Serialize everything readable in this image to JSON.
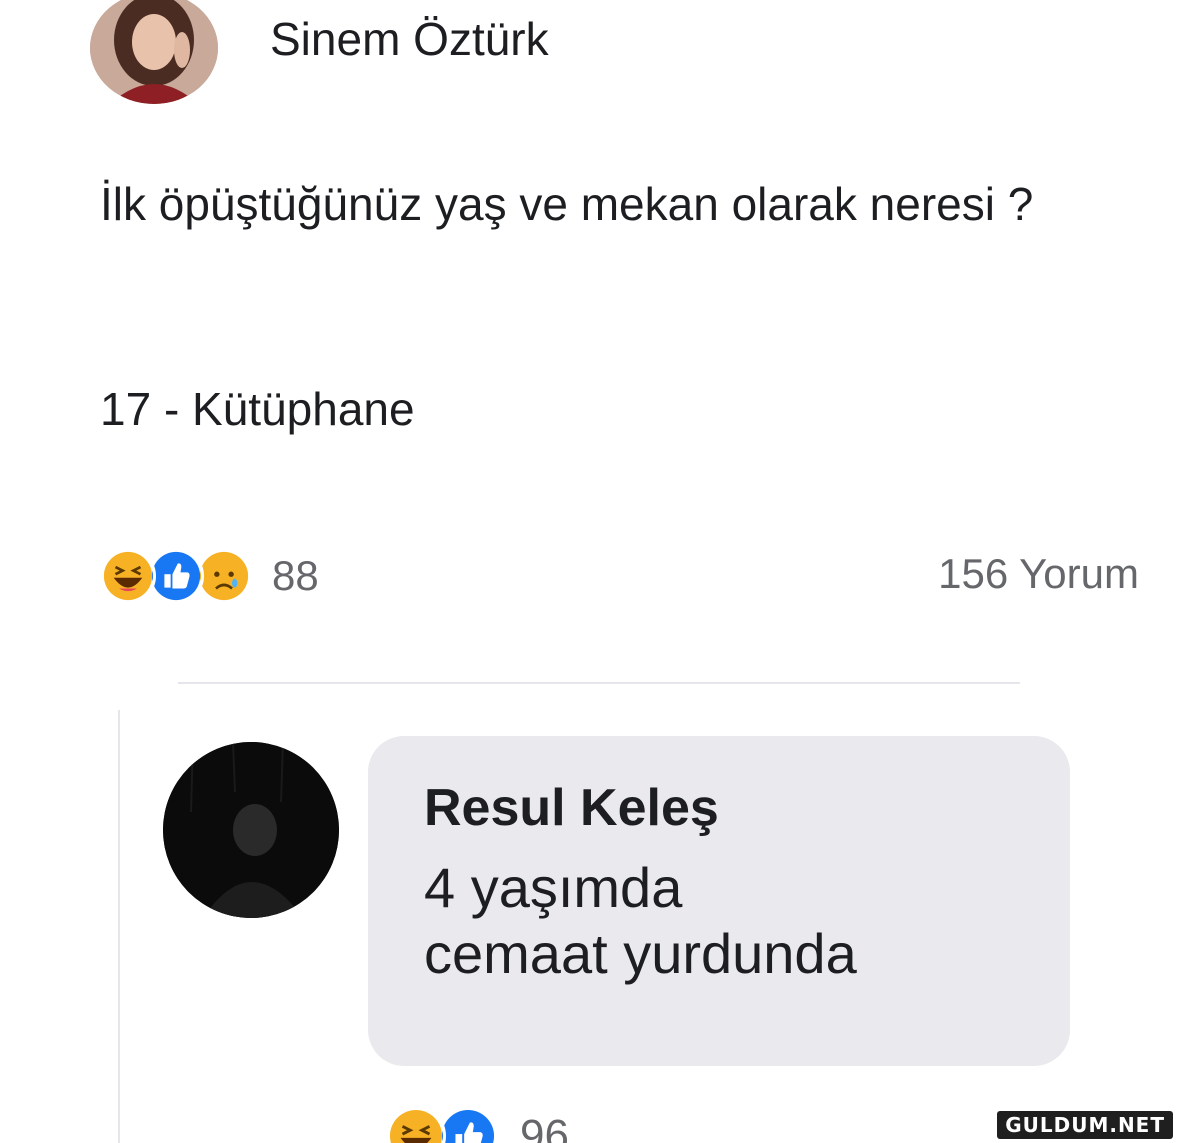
{
  "post": {
    "author": "Sinem Öztürk",
    "text": "İlk öpüştüğünüz yaş ve mekan olarak neresi ?",
    "answer": "17 - Kütüphane",
    "reaction_count": "88",
    "comment_count": "156 Yorum",
    "reactions": [
      "haha-icon",
      "like-icon",
      "sad-icon"
    ]
  },
  "comment": {
    "author": "Resul Keleş",
    "text": "4 yaşımda\n cemaat yurdunda",
    "reaction_count": "96",
    "reactions": [
      "haha-icon",
      "like-icon"
    ]
  },
  "watermark": "GULDUM.NET",
  "colors": {
    "like_blue": "#1877f2",
    "haha_yellow": "#f7b125",
    "meta_gray": "#65676b",
    "bubble_bg": "#e9e9ee"
  }
}
